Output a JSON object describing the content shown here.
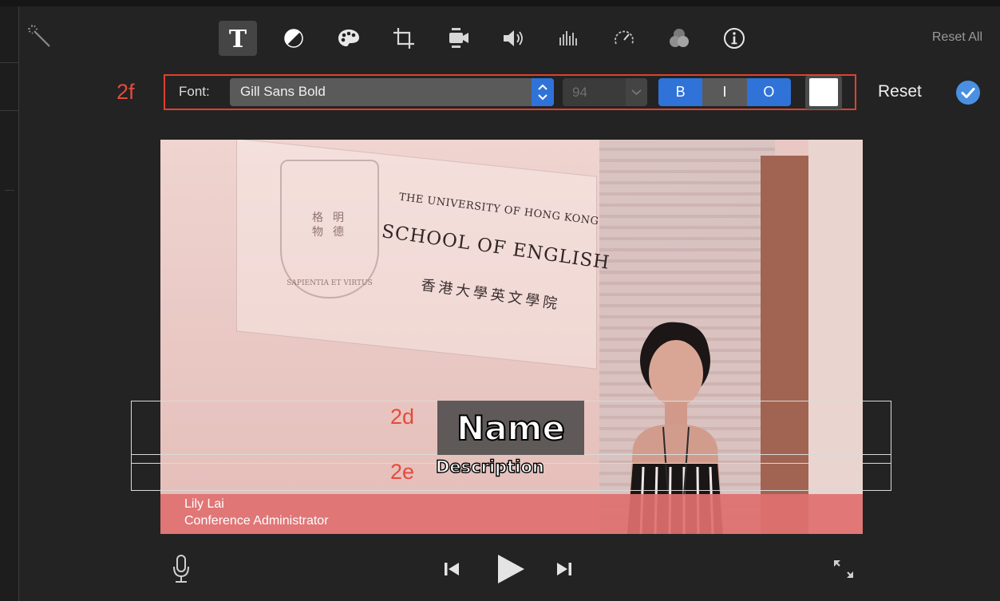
{
  "toolbar": {
    "reset_all_label": "Reset All",
    "tools": [
      {
        "name": "title-text",
        "icon": "text-T-icon",
        "active": true
      },
      {
        "name": "color-balance",
        "icon": "color-balance-icon"
      },
      {
        "name": "color-correction",
        "icon": "palette-icon"
      },
      {
        "name": "crop",
        "icon": "crop-icon"
      },
      {
        "name": "stabilization",
        "icon": "camera-stabilization-icon"
      },
      {
        "name": "volume",
        "icon": "volume-icon"
      },
      {
        "name": "noise-reduction",
        "icon": "equalizer-icon"
      },
      {
        "name": "speed",
        "icon": "speedometer-icon"
      },
      {
        "name": "clip-filter",
        "icon": "filter-circles-icon"
      },
      {
        "name": "info",
        "icon": "info-icon"
      }
    ]
  },
  "font_bar": {
    "annotation": "2f",
    "font_label": "Font:",
    "font_value": "Gill Sans Bold",
    "size_value": "94",
    "bold_label": "B",
    "italic_label": "I",
    "outline_label": "O",
    "color_swatch": "#ffffff",
    "reset_label": "Reset",
    "accent": "#2f73d9",
    "annotation_color": "#e64a3c"
  },
  "viewer": {
    "plaque": {
      "line1": "THE UNIVERSITY OF HONG KONG",
      "line2": "SCHOOL OF ENGLISH",
      "line3": "香港大學英文學院",
      "crest_chars": "格 明 物 德",
      "crest_motto": "SAPIENTIA ET VIRTUS"
    },
    "lower_third": {
      "name": "Lily Lai",
      "description": "Conference Administrator"
    },
    "title_name": "Name",
    "title_description": "Description",
    "annotation_name": "2d",
    "annotation_description": "2e"
  },
  "playback": {
    "microphone": "microphone-icon",
    "previous": "skip-back-icon",
    "play": "play-icon",
    "next": "skip-forward-icon",
    "fullscreen": "fullscreen-icon"
  }
}
